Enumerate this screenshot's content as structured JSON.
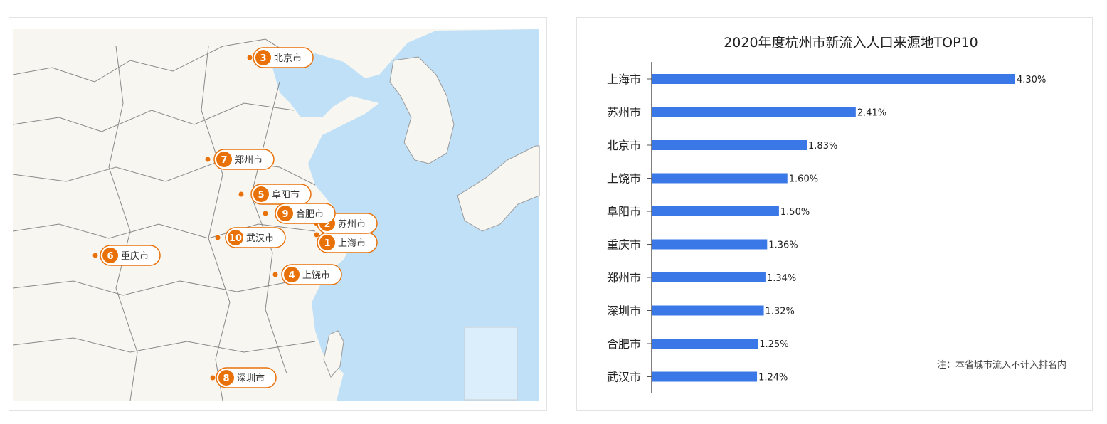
{
  "colors": {
    "bar": "#3b78e7",
    "marker": "#e8710a",
    "sea": "#bfe0f7",
    "land": "#f8f6f1",
    "border": "#7a7a7a"
  },
  "map": {
    "markers": [
      {
        "rank": "1",
        "city": "上海市"
      },
      {
        "rank": "2",
        "city": "苏州市"
      },
      {
        "rank": "3",
        "city": "北京市"
      },
      {
        "rank": "4",
        "city": "上饶市"
      },
      {
        "rank": "5",
        "city": "阜阳市"
      },
      {
        "rank": "6",
        "city": "重庆市"
      },
      {
        "rank": "7",
        "city": "郑州市"
      },
      {
        "rank": "8",
        "city": "深圳市"
      },
      {
        "rank": "9",
        "city": "合肥市"
      },
      {
        "rank": "10",
        "city": "武汉市"
      }
    ]
  },
  "chart_data": {
    "type": "bar",
    "orientation": "horizontal",
    "title": "2020年度杭州市新流入人口来源地TOP10",
    "categories": [
      "上海市",
      "苏州市",
      "北京市",
      "上饶市",
      "阜阳市",
      "重庆市",
      "郑州市",
      "深圳市",
      "合肥市",
      "武汉市"
    ],
    "values": [
      4.3,
      2.41,
      1.83,
      1.6,
      1.5,
      1.36,
      1.34,
      1.32,
      1.25,
      1.24
    ],
    "value_labels": [
      "4.30%",
      "2.41%",
      "1.83%",
      "1.60%",
      "1.50%",
      "1.36%",
      "1.34%",
      "1.32%",
      "1.25%",
      "1.24%"
    ],
    "xlim": [
      0,
      4.3
    ],
    "grid": false,
    "note": "注：本省城市流入不计入排名内"
  }
}
